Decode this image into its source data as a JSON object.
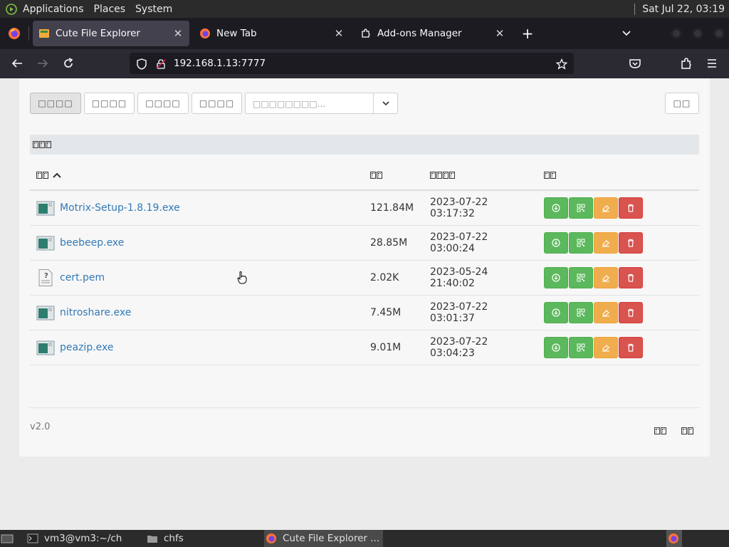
{
  "os_panel": {
    "menu": [
      "Applications",
      "Places",
      "System"
    ],
    "clock": "Sat Jul 22, 03:19"
  },
  "browser": {
    "tabs": [
      {
        "label": "Cute File Explorer",
        "active": true
      },
      {
        "label": "New Tab",
        "active": false
      },
      {
        "label": "Add-ons Manager",
        "active": false
      }
    ],
    "new_tab": "+",
    "url": "192.168.1.13:7777"
  },
  "page": {
    "toolbar": {
      "btn1": "□□□□",
      "btn2": "□□□□",
      "btn3": "□□□□",
      "btn4": "□□□□",
      "filter_placeholder": "□□□□□□□□...",
      "right_btn": "□□"
    },
    "table": {
      "columns": [
        "name",
        "size",
        "modified",
        "actions"
      ],
      "rows": [
        {
          "name": "Motrix-Setup-1.8.19.exe",
          "size": "121.84M",
          "date": "2023-07-22 03:17:32",
          "type": "exe"
        },
        {
          "name": "beebeep.exe",
          "size": "28.85M",
          "date": "2023-07-22 03:00:24",
          "type": "exe"
        },
        {
          "name": "cert.pem",
          "size": "2.02K",
          "date": "2023-05-24 21:40:02",
          "type": "unknown"
        },
        {
          "name": "nitroshare.exe",
          "size": "7.45M",
          "date": "2023-07-22 03:01:37",
          "type": "exe"
        },
        {
          "name": "peazip.exe",
          "size": "9.01M",
          "date": "2023-07-22 03:04:23",
          "type": "exe"
        }
      ]
    },
    "version": "v2.0"
  },
  "taskbar": {
    "items": [
      "vm3@vm3:~/ch",
      "chfs",
      "Cute File Explorer ..."
    ]
  },
  "colors": {
    "link": "#337ab7",
    "btn_green": "#5cb85c",
    "btn_orange": "#f0ad4e",
    "btn_red": "#d9534f"
  }
}
